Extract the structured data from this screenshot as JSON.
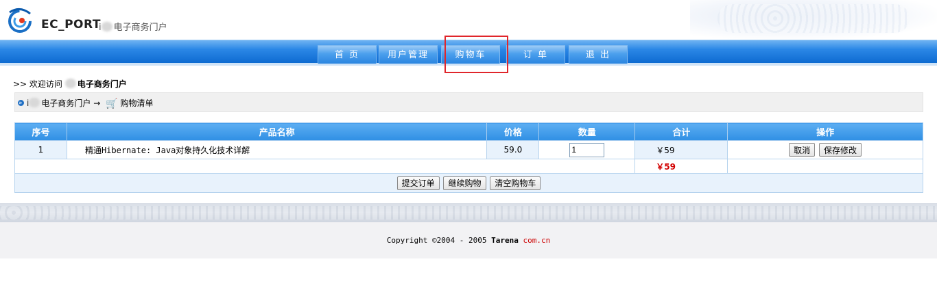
{
  "header": {
    "brand": "EC_PORT",
    "subtitle_prefix": "i",
    "subtitle_suffix": "电子商务门户"
  },
  "nav": {
    "items": [
      "首 页",
      "用户管理",
      "购物车",
      "订 单",
      "退 出"
    ],
    "highlighted": "购物车"
  },
  "welcome": {
    "prefix": ">> 欢迎访问",
    "portal": "电子商务门户"
  },
  "breadcrumb": {
    "site_prefix": "i",
    "site": "电子商务门户",
    "arrow": "→",
    "page": "购物清单"
  },
  "table": {
    "headers": [
      "序号",
      "产品名称",
      "价格",
      "数量",
      "合计",
      "操作"
    ],
    "rows": [
      {
        "index": "1",
        "name": "精通Hibernate: Java对象持久化技术详解",
        "price": "59.0",
        "quantity": "1",
        "subtotal": "￥59",
        "actions": [
          "取消",
          "保存修改"
        ]
      }
    ],
    "total": "￥59",
    "bottom_buttons": [
      "提交订单",
      "继续购物",
      "清空购物车"
    ]
  },
  "footer": {
    "copyright": "Copyright ©2004 - 2005",
    "brand": "Tarena",
    "domain": "com.cn"
  },
  "colors": {
    "nav_blue": "#2b87e6",
    "highlight_red": "#e0262b",
    "total_red": "#d20000"
  }
}
